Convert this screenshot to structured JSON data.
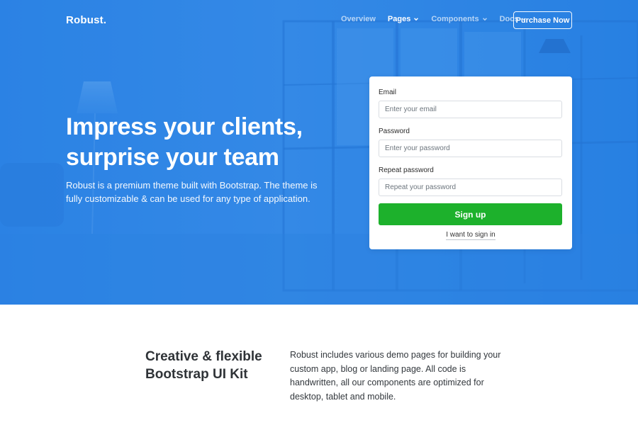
{
  "brand": {
    "name": "Robust."
  },
  "nav": {
    "items": [
      {
        "label": "Overview",
        "active": false,
        "has_dropdown": false
      },
      {
        "label": "Pages",
        "active": true,
        "has_dropdown": true
      },
      {
        "label": "Components",
        "active": false,
        "has_dropdown": true
      },
      {
        "label": "Docs",
        "active": false,
        "has_dropdown": true
      }
    ],
    "purchase_label": "Purchase Now"
  },
  "hero": {
    "title_line1": "Impress your clients,",
    "title_line2": "surprise your team",
    "description": "Robust is a premium theme built with Bootstrap. The theme is fully customizable & can be used for any type of application."
  },
  "form": {
    "email_label": "Email",
    "email_placeholder": "Enter your email",
    "password_label": "Password",
    "password_placeholder": "Enter your password",
    "repeat_label": "Repeat password",
    "repeat_placeholder": "Repeat your password",
    "submit_label": "Sign up",
    "signin_label": "I want to sign in"
  },
  "feature": {
    "title_line1": "Creative & flexible",
    "title_line2": "Bootstrap UI Kit",
    "text": "Robust includes various demo pages for building your custom app, blog or landing page. All code is handwritten, all our components are optimized for desktop, tablet and mobile."
  },
  "colors": {
    "hero_blue": "#2f86e6",
    "signup_green": "#1db12c",
    "heading_dark": "#2f3337"
  },
  "icons": {
    "dropdown": "chevron-down-icon"
  }
}
